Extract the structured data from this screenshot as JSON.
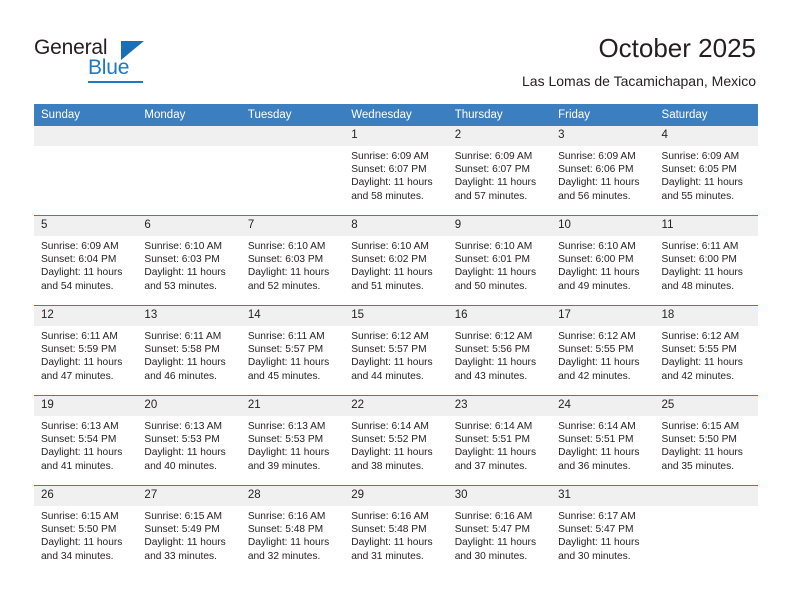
{
  "brand": {
    "word_one": "General",
    "word_two": "Blue",
    "triangle_icon": "triangle-icon",
    "accent_color": "#1f7ac2"
  },
  "header": {
    "title": "October 2025",
    "subtitle": "Las Lomas de Tacamichapan, Mexico"
  },
  "calendar": {
    "header_bg": "#3c7fc1",
    "daynum_bg": "#f0f0f0",
    "weekday_headers": [
      "Sunday",
      "Monday",
      "Tuesday",
      "Wednesday",
      "Thursday",
      "Friday",
      "Saturday"
    ],
    "weeks": [
      [
        {
          "day": "",
          "empty": true
        },
        {
          "day": "",
          "empty": true
        },
        {
          "day": "",
          "empty": true
        },
        {
          "day": "1",
          "sunrise": "Sunrise: 6:09 AM",
          "sunset": "Sunset: 6:07 PM",
          "daylight": "Daylight: 11 hours and 58 minutes."
        },
        {
          "day": "2",
          "sunrise": "Sunrise: 6:09 AM",
          "sunset": "Sunset: 6:07 PM",
          "daylight": "Daylight: 11 hours and 57 minutes."
        },
        {
          "day": "3",
          "sunrise": "Sunrise: 6:09 AM",
          "sunset": "Sunset: 6:06 PM",
          "daylight": "Daylight: 11 hours and 56 minutes."
        },
        {
          "day": "4",
          "sunrise": "Sunrise: 6:09 AM",
          "sunset": "Sunset: 6:05 PM",
          "daylight": "Daylight: 11 hours and 55 minutes."
        }
      ],
      [
        {
          "day": "5",
          "sunrise": "Sunrise: 6:09 AM",
          "sunset": "Sunset: 6:04 PM",
          "daylight": "Daylight: 11 hours and 54 minutes."
        },
        {
          "day": "6",
          "sunrise": "Sunrise: 6:10 AM",
          "sunset": "Sunset: 6:03 PM",
          "daylight": "Daylight: 11 hours and 53 minutes."
        },
        {
          "day": "7",
          "sunrise": "Sunrise: 6:10 AM",
          "sunset": "Sunset: 6:03 PM",
          "daylight": "Daylight: 11 hours and 52 minutes."
        },
        {
          "day": "8",
          "sunrise": "Sunrise: 6:10 AM",
          "sunset": "Sunset: 6:02 PM",
          "daylight": "Daylight: 11 hours and 51 minutes."
        },
        {
          "day": "9",
          "sunrise": "Sunrise: 6:10 AM",
          "sunset": "Sunset: 6:01 PM",
          "daylight": "Daylight: 11 hours and 50 minutes."
        },
        {
          "day": "10",
          "sunrise": "Sunrise: 6:10 AM",
          "sunset": "Sunset: 6:00 PM",
          "daylight": "Daylight: 11 hours and 49 minutes."
        },
        {
          "day": "11",
          "sunrise": "Sunrise: 6:11 AM",
          "sunset": "Sunset: 6:00 PM",
          "daylight": "Daylight: 11 hours and 48 minutes."
        }
      ],
      [
        {
          "day": "12",
          "sunrise": "Sunrise: 6:11 AM",
          "sunset": "Sunset: 5:59 PM",
          "daylight": "Daylight: 11 hours and 47 minutes."
        },
        {
          "day": "13",
          "sunrise": "Sunrise: 6:11 AM",
          "sunset": "Sunset: 5:58 PM",
          "daylight": "Daylight: 11 hours and 46 minutes."
        },
        {
          "day": "14",
          "sunrise": "Sunrise: 6:11 AM",
          "sunset": "Sunset: 5:57 PM",
          "daylight": "Daylight: 11 hours and 45 minutes."
        },
        {
          "day": "15",
          "sunrise": "Sunrise: 6:12 AM",
          "sunset": "Sunset: 5:57 PM",
          "daylight": "Daylight: 11 hours and 44 minutes."
        },
        {
          "day": "16",
          "sunrise": "Sunrise: 6:12 AM",
          "sunset": "Sunset: 5:56 PM",
          "daylight": "Daylight: 11 hours and 43 minutes."
        },
        {
          "day": "17",
          "sunrise": "Sunrise: 6:12 AM",
          "sunset": "Sunset: 5:55 PM",
          "daylight": "Daylight: 11 hours and 42 minutes."
        },
        {
          "day": "18",
          "sunrise": "Sunrise: 6:12 AM",
          "sunset": "Sunset: 5:55 PM",
          "daylight": "Daylight: 11 hours and 42 minutes."
        }
      ],
      [
        {
          "day": "19",
          "sunrise": "Sunrise: 6:13 AM",
          "sunset": "Sunset: 5:54 PM",
          "daylight": "Daylight: 11 hours and 41 minutes."
        },
        {
          "day": "20",
          "sunrise": "Sunrise: 6:13 AM",
          "sunset": "Sunset: 5:53 PM",
          "daylight": "Daylight: 11 hours and 40 minutes."
        },
        {
          "day": "21",
          "sunrise": "Sunrise: 6:13 AM",
          "sunset": "Sunset: 5:53 PM",
          "daylight": "Daylight: 11 hours and 39 minutes."
        },
        {
          "day": "22",
          "sunrise": "Sunrise: 6:14 AM",
          "sunset": "Sunset: 5:52 PM",
          "daylight": "Daylight: 11 hours and 38 minutes."
        },
        {
          "day": "23",
          "sunrise": "Sunrise: 6:14 AM",
          "sunset": "Sunset: 5:51 PM",
          "daylight": "Daylight: 11 hours and 37 minutes."
        },
        {
          "day": "24",
          "sunrise": "Sunrise: 6:14 AM",
          "sunset": "Sunset: 5:51 PM",
          "daylight": "Daylight: 11 hours and 36 minutes."
        },
        {
          "day": "25",
          "sunrise": "Sunrise: 6:15 AM",
          "sunset": "Sunset: 5:50 PM",
          "daylight": "Daylight: 11 hours and 35 minutes."
        }
      ],
      [
        {
          "day": "26",
          "sunrise": "Sunrise: 6:15 AM",
          "sunset": "Sunset: 5:50 PM",
          "daylight": "Daylight: 11 hours and 34 minutes."
        },
        {
          "day": "27",
          "sunrise": "Sunrise: 6:15 AM",
          "sunset": "Sunset: 5:49 PM",
          "daylight": "Daylight: 11 hours and 33 minutes."
        },
        {
          "day": "28",
          "sunrise": "Sunrise: 6:16 AM",
          "sunset": "Sunset: 5:48 PM",
          "daylight": "Daylight: 11 hours and 32 minutes."
        },
        {
          "day": "29",
          "sunrise": "Sunrise: 6:16 AM",
          "sunset": "Sunset: 5:48 PM",
          "daylight": "Daylight: 11 hours and 31 minutes."
        },
        {
          "day": "30",
          "sunrise": "Sunrise: 6:16 AM",
          "sunset": "Sunset: 5:47 PM",
          "daylight": "Daylight: 11 hours and 30 minutes."
        },
        {
          "day": "31",
          "sunrise": "Sunrise: 6:17 AM",
          "sunset": "Sunset: 5:47 PM",
          "daylight": "Daylight: 11 hours and 30 minutes."
        },
        {
          "day": "",
          "empty": true
        }
      ]
    ]
  }
}
